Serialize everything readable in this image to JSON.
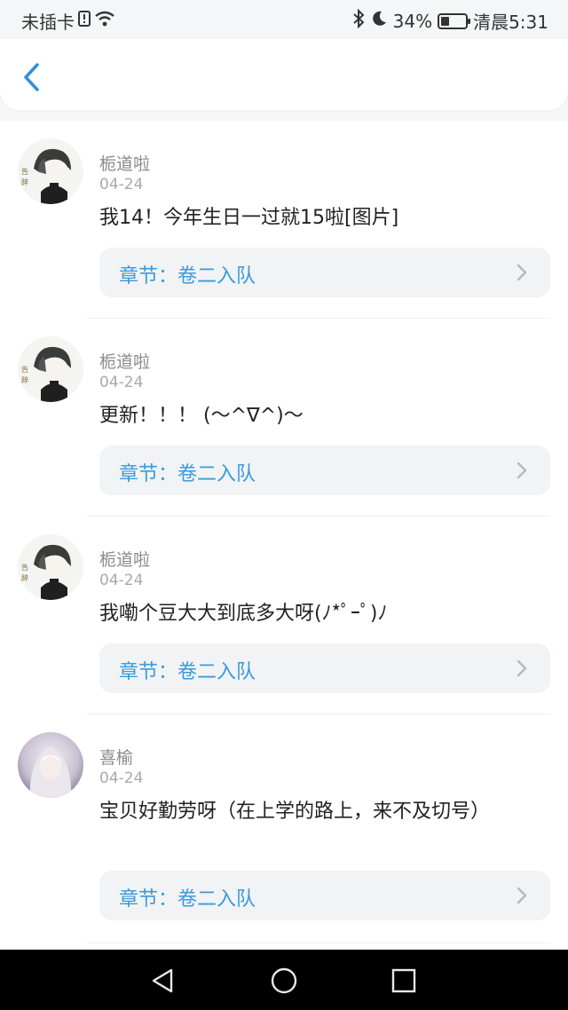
{
  "status_bar": {
    "carrier": "未插卡",
    "battery": "34%",
    "time": "清晨5:31",
    "battery_level": 0.34
  },
  "comments": [
    {
      "name": "栀道啦",
      "date": "04-24",
      "text": "我14！今年生日一过就15啦[图片]",
      "chapter": "章节：卷二入队",
      "avatar": "anime-avatar-dark"
    },
    {
      "name": "栀道啦",
      "date": "04-24",
      "text": "更新！！！ (～^∇^)～",
      "chapter": "章节：卷二入队",
      "avatar": "anime-avatar-dark"
    },
    {
      "name": "栀道啦",
      "date": "04-24",
      "text": "我嘞个豆大大到底多大呀(ﾉ*ﾟｰﾟ)ﾉ",
      "chapter": "章节：卷二入队",
      "avatar": "anime-avatar-dark"
    },
    {
      "name": "喜榆",
      "date": "04-24",
      "text": "宝贝好勤劳呀（在上学的路上，来不及切号）",
      "chapter": "章节：卷二入队",
      "avatar": "anime-avatar-light"
    }
  ],
  "colors": {
    "accent": "#3a9bdc",
    "back_icon": "#2f8fdc"
  }
}
